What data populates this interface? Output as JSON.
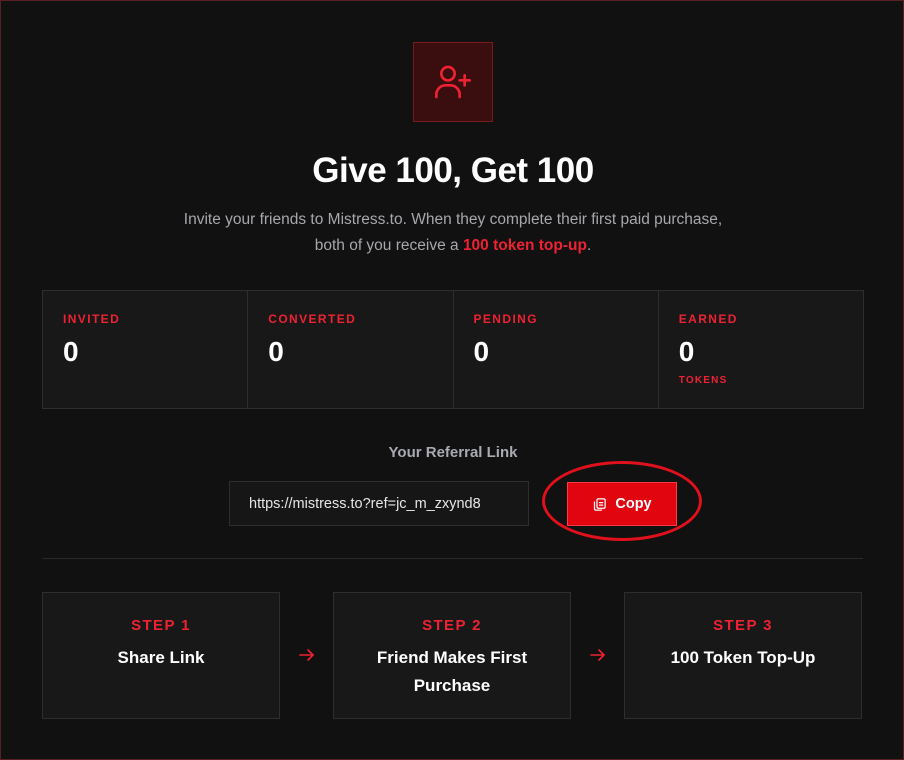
{
  "header": {
    "icon": "user-plus-icon",
    "title": "Give 100, Get 100",
    "subtitle_part1": "Invite your friends to Mistress.to. When they complete their first paid purchase, both of you receive a ",
    "subtitle_highlight": "100 token top-up",
    "subtitle_part2": "."
  },
  "stats": [
    {
      "label": "INVITED",
      "value": "0"
    },
    {
      "label": "CONVERTED",
      "value": "0"
    },
    {
      "label": "PENDING",
      "value": "0"
    },
    {
      "label": "EARNED",
      "value": "0",
      "unit": "TOKENS"
    }
  ],
  "referral": {
    "label": "Your Referral Link",
    "link": "https://mistress.to?ref=jc_m_zxynd8",
    "copy_label": "Copy",
    "copy_icon": "copy-icon"
  },
  "steps": [
    {
      "number": "STEP 1",
      "title": "Share Link"
    },
    {
      "number": "STEP 2",
      "title": "Friend Makes First Purchase"
    },
    {
      "number": "STEP 3",
      "title": "100 Token Top-Up"
    }
  ],
  "colors": {
    "accent": "#ee2233",
    "button": "#e0050f",
    "background": "#111111",
    "card": "#181818",
    "border": "#2e2e2e"
  }
}
